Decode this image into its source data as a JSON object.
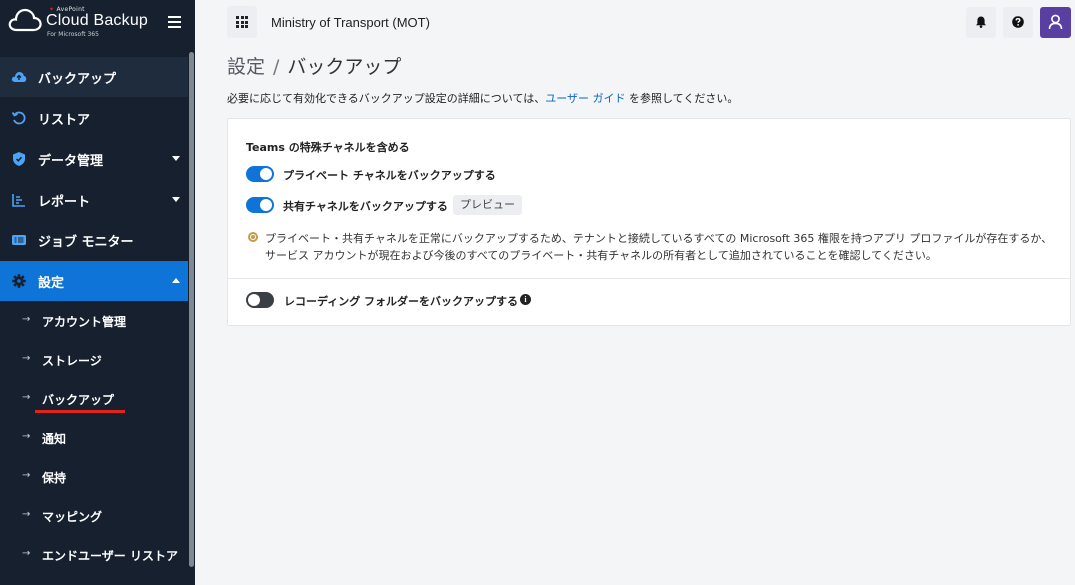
{
  "brand": {
    "superscript_red": "✦",
    "superscript": "AvePoint",
    "title": "Cloud Backup",
    "subtitle": "For Microsoft 365"
  },
  "sidebar": {
    "items": [
      {
        "label": "バックアップ",
        "icon": "cloud-upload-icon"
      },
      {
        "label": "リストア",
        "icon": "restore-icon"
      },
      {
        "label": "データ管理",
        "icon": "shield-icon"
      },
      {
        "label": "レポート",
        "icon": "report-icon"
      },
      {
        "label": "ジョブ モニター",
        "icon": "monitor-icon"
      },
      {
        "label": "設定",
        "icon": "gear-icon"
      }
    ],
    "sub_items": [
      {
        "label": "アカウント管理"
      },
      {
        "label": "ストレージ"
      },
      {
        "label": "バックアップ"
      },
      {
        "label": "通知"
      },
      {
        "label": "保持"
      },
      {
        "label": "マッピング"
      },
      {
        "label": "エンドユーザー リストア"
      }
    ],
    "sub_arrow": "→"
  },
  "header": {
    "tenant": "Ministry of Transport (MOT)"
  },
  "breadcrumb": {
    "parent": "設定",
    "separator": "/",
    "current": "バックアップ"
  },
  "description": {
    "before": "必要に応じて有効化できるバックアップ設定の詳細については、",
    "link": "ユーザー ガイド",
    "after": " を参照してください。"
  },
  "settings": {
    "section_title": "Teams の特殊チャネルを含める",
    "private_channel": {
      "label": "プライベート チャネルをバックアップする",
      "enabled": true
    },
    "shared_channel": {
      "label": "共有チャネルをバックアップする",
      "enabled": true,
      "badge": "プレビュー"
    },
    "note": "プライベート・共有チャネルを正常にバックアップするため、テナントと接続しているすべての Microsoft 365 権限を持つアプリ プロファイルが存在するか、サービス アカウントが現在および今後のすべてのプライベート・共有チャネルの所有者として追加されていることを確認してください。",
    "recording_folder": {
      "label": "レコーディング フォルダーをバックアップする",
      "enabled": false,
      "info": "i"
    }
  },
  "colors": {
    "sidebar_bg": "#16202e",
    "active_blue": "#0e74d8",
    "profile_purple": "#5a3fa3",
    "underline_red": "#e2231a"
  }
}
